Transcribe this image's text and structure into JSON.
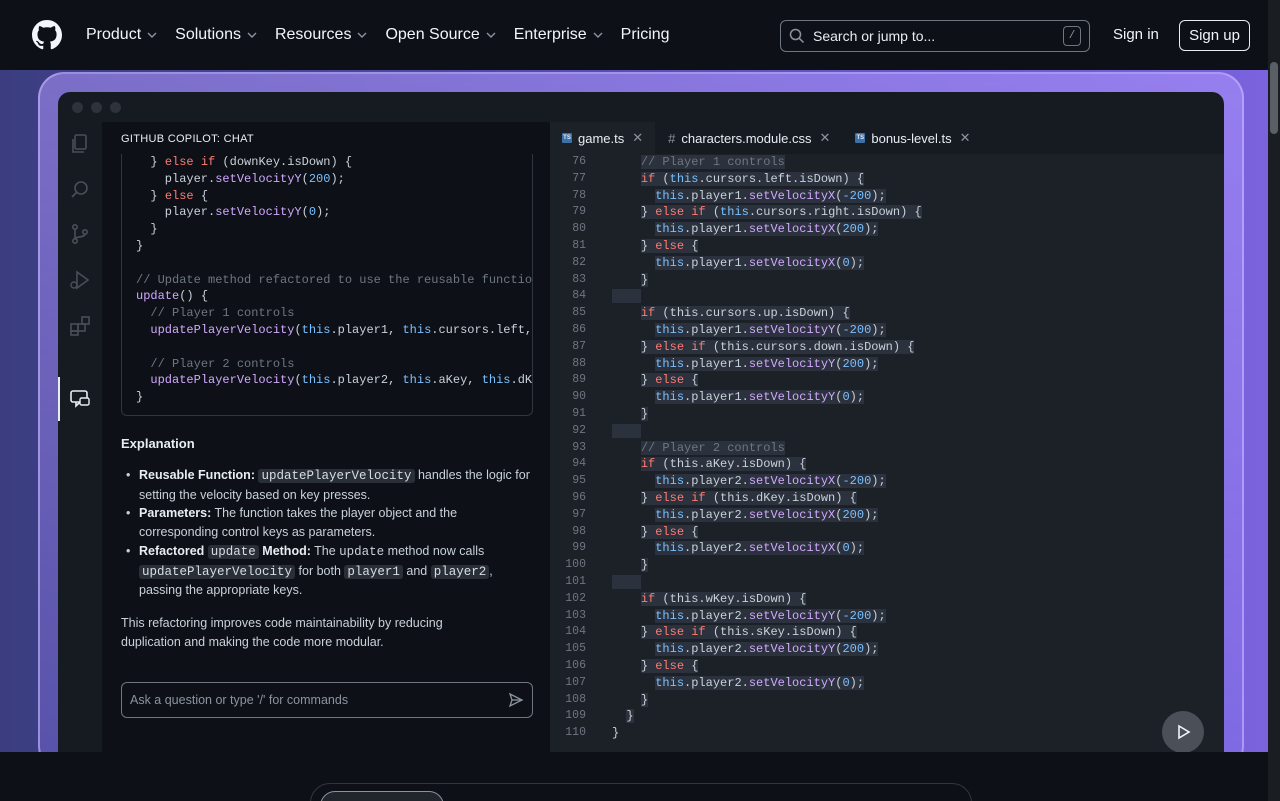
{
  "nav": {
    "items": [
      {
        "label": "Product",
        "dropdown": true
      },
      {
        "label": "Solutions",
        "dropdown": true
      },
      {
        "label": "Resources",
        "dropdown": true
      },
      {
        "label": "Open Source",
        "dropdown": true
      },
      {
        "label": "Enterprise",
        "dropdown": true
      },
      {
        "label": "Pricing",
        "dropdown": false
      }
    ],
    "search_placeholder": "Search or jump to...",
    "search_shortcut": "/",
    "sign_in": "Sign in",
    "sign_up": "Sign up"
  },
  "chat": {
    "title": "GITHUB COPILOT: CHAT",
    "explanation_heading": "Explanation",
    "bullets": [
      {
        "bold": "Reusable Function:",
        "code": "updatePlayerVelocity",
        "text": "handles the logic for setting the velocity based on key presses."
      },
      {
        "bold": "Parameters:",
        "text": "The function takes the player object and the corresponding control keys as parameters."
      },
      {
        "bold_pre": "Refactored",
        "bold_code": "update",
        "bold_post": "Method:",
        "text_pre": "The",
        "text_code": "update",
        "text_mid": "method now calls",
        "code1": "updatePlayerVelocity",
        "text_mid2": "for both",
        "code2": "player1",
        "text_and": "and",
        "code3": "player2",
        "text_end": ", passing the appropriate keys."
      }
    ],
    "summary": "This refactoring improves code maintainability by reducing duplication and making the code more modular.",
    "input_placeholder": "Ask a question or type '/' for commands"
  },
  "editor": {
    "tabs": [
      {
        "label": "game.ts",
        "icon": "typescript-icon",
        "active": true
      },
      {
        "label": "characters.module.css",
        "icon": "hash-icon",
        "active": false
      },
      {
        "label": "bonus-level.ts",
        "icon": "typescript-icon",
        "active": false
      }
    ],
    "line_start": 76,
    "line_end": 110
  },
  "colors": {
    "accent": "#7a63dd",
    "keyword": "#ff7b72",
    "function": "#d2a8ff",
    "number": "#79c0ff"
  }
}
